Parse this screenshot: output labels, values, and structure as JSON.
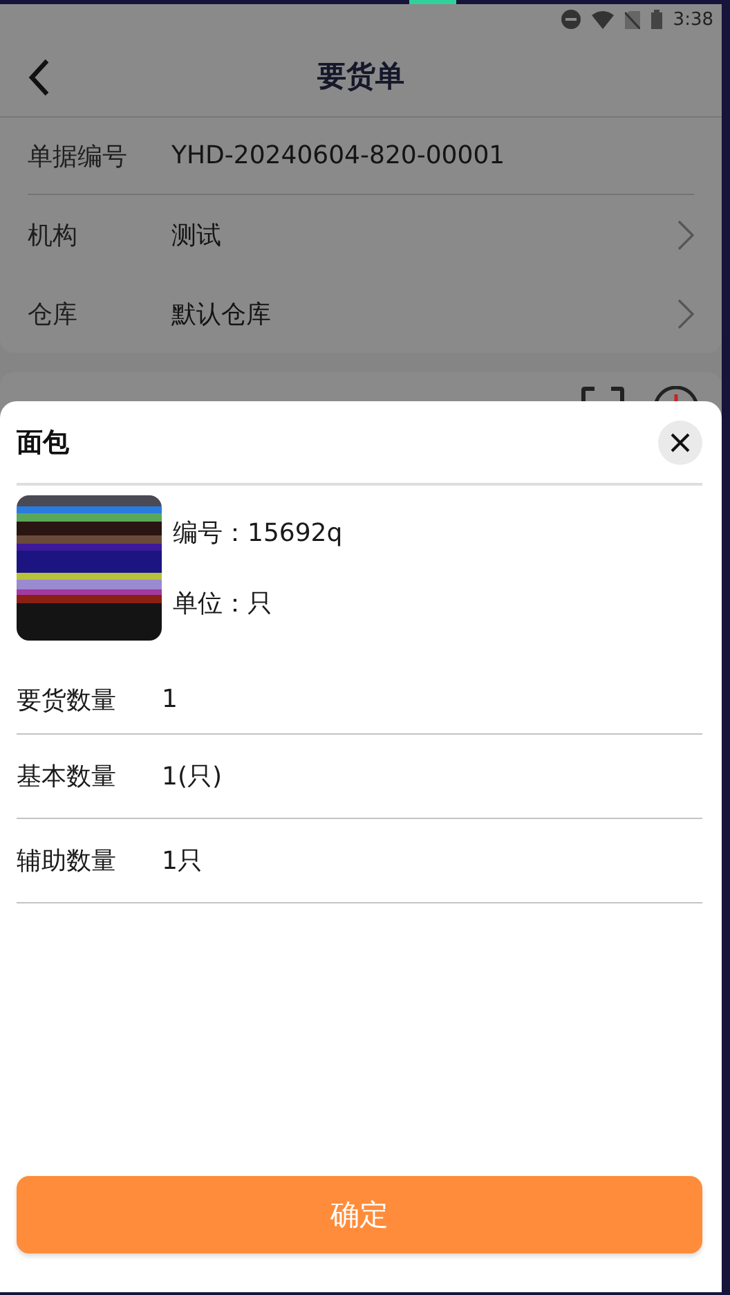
{
  "status_bar": {
    "time": "3:38"
  },
  "header": {
    "title": "要货单"
  },
  "order_fields": [
    {
      "label": "单据编号",
      "value": "YHD-20240604-820-00001",
      "kind": "text"
    },
    {
      "label": "机构",
      "value": "测试",
      "kind": "link"
    },
    {
      "label": "仓库",
      "value": "默认仓库",
      "kind": "link"
    }
  ],
  "sheet": {
    "title": "面包",
    "image": {
      "kind": "picture"
    },
    "details": [
      "编号：15692q",
      "单位：只"
    ],
    "quantities": [
      {
        "label": "要货数量",
        "value": "1"
      },
      {
        "label": "基本数量",
        "value": "1(只)"
      },
      {
        "label": "辅助数量",
        "value": "1只"
      }
    ],
    "confirm_button": "确定"
  }
}
